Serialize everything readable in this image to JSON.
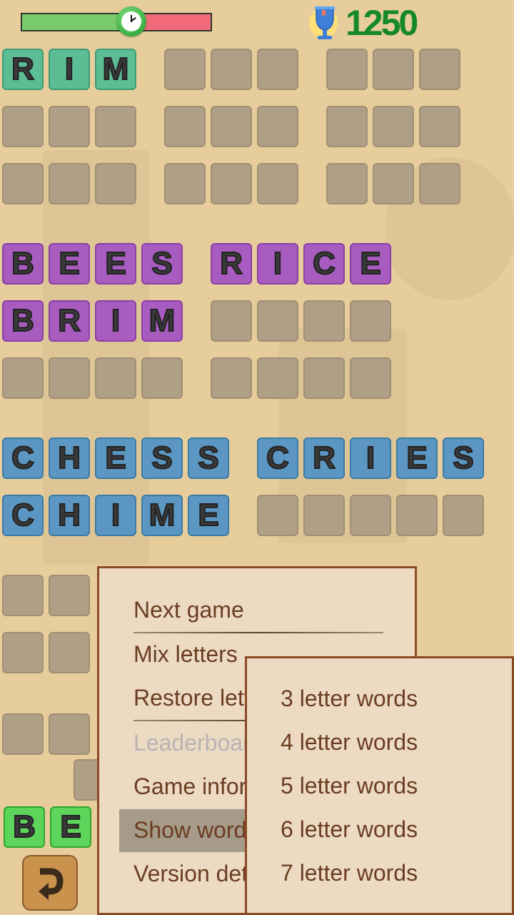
{
  "header": {
    "timer_progress": 0.58,
    "score": "1250",
    "icons": {
      "timer": "clock-icon",
      "score": "trophy-icon"
    }
  },
  "boards": {
    "three_letter": {
      "color": "#5cbc93",
      "columns": [
        [
          {
            "word": "RIM"
          },
          {
            "word": ""
          },
          {
            "word": ""
          }
        ],
        [
          {
            "word": ""
          },
          {
            "word": ""
          },
          {
            "word": ""
          }
        ],
        [
          {
            "word": ""
          },
          {
            "word": ""
          },
          {
            "word": ""
          }
        ]
      ]
    },
    "four_letter": {
      "color": "#a85cc0",
      "columns": [
        [
          {
            "word": "BEES"
          },
          {
            "word": "BRIM"
          },
          {
            "word": ""
          }
        ],
        [
          {
            "word": "RICE"
          },
          {
            "word": ""
          },
          {
            "word": ""
          }
        ]
      ]
    },
    "five_letter": {
      "color": "#5b97c2",
      "columns": [
        [
          {
            "word": "CHESS"
          },
          {
            "word": "CHIME"
          }
        ],
        [
          {
            "word": "CRIES"
          },
          {
            "word": ""
          }
        ]
      ]
    }
  },
  "current_input": {
    "letters": [
      "B",
      "E"
    ],
    "color": "#5dd55b"
  },
  "undo_button": {
    "icon": "undo-arrow-icon"
  },
  "menu": {
    "items": [
      {
        "label": "Next game",
        "enabled": true
      },
      {
        "label": "Mix letters",
        "enabled": true
      },
      {
        "label": "Restore letters",
        "enabled": true
      },
      {
        "label": "Leaderboard",
        "enabled": false
      },
      {
        "label": "Game information",
        "enabled": true
      },
      {
        "label": "Show words",
        "enabled": true,
        "highlighted": true
      },
      {
        "label": "Version details",
        "enabled": true
      }
    ]
  },
  "submenu": {
    "items": [
      {
        "label": "3 letter words"
      },
      {
        "label": "4 letter words"
      },
      {
        "label": "5 letter words"
      },
      {
        "label": "6 letter words"
      },
      {
        "label": "7 letter words"
      }
    ]
  }
}
